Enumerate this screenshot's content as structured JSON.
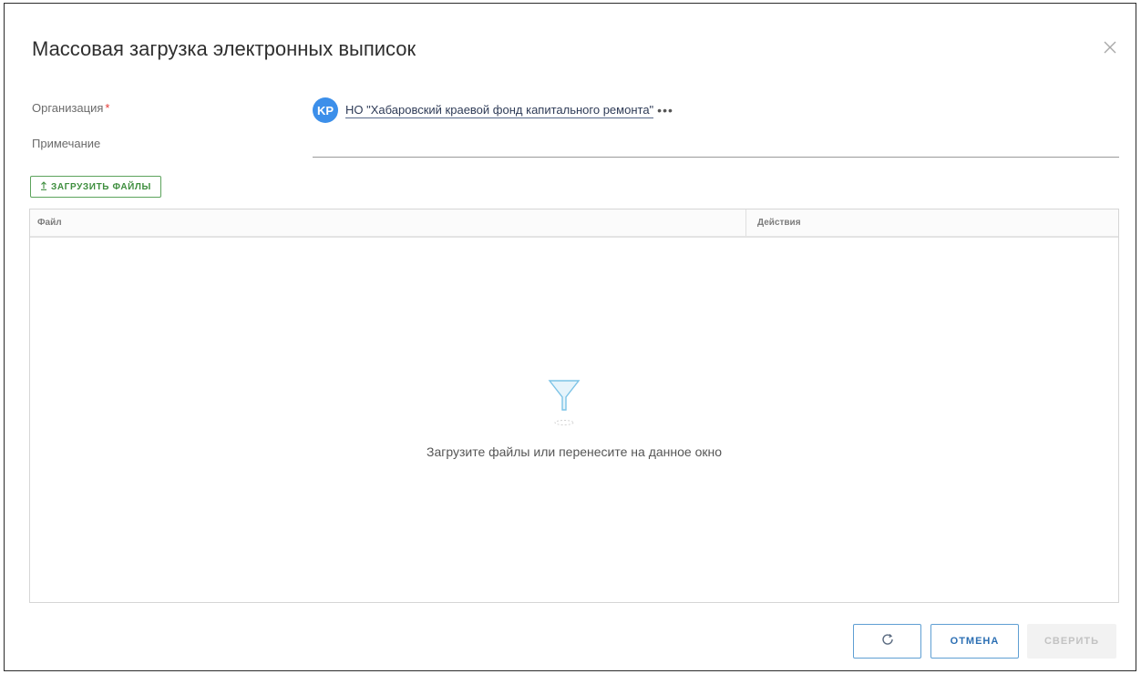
{
  "dialog": {
    "title": "Массовая загрузка электронных выписок",
    "close_icon": "close-icon"
  },
  "form": {
    "organization_label": "Организация",
    "required_mark": "*",
    "organization_avatar": "KP",
    "organization_value": "НО \"Хабаровский краевой фонд капитального ремонта\"",
    "organization_more": "•••",
    "note_label": "Примечание",
    "note_value": ""
  },
  "toolbar": {
    "upload_icon": "upload-arrow-icon",
    "upload_label": "ЗАГРУЗИТЬ ФАЙЛЫ"
  },
  "grid": {
    "columns": [
      "Файл",
      "Действия"
    ],
    "rows": [],
    "empty_icon": "funnel-icon",
    "empty_message": "Загрузите файлы или перенесите на данное окно"
  },
  "footer": {
    "refresh_icon": "refresh-icon",
    "cancel_label": "ОТМЕНА",
    "verify_label": "СВЕРИТЬ"
  },
  "colors": {
    "accent_blue": "#3c8fea",
    "upload_green": "#3e8e3e",
    "required_red": "#e53935",
    "button_border": "#5f9fd3"
  }
}
